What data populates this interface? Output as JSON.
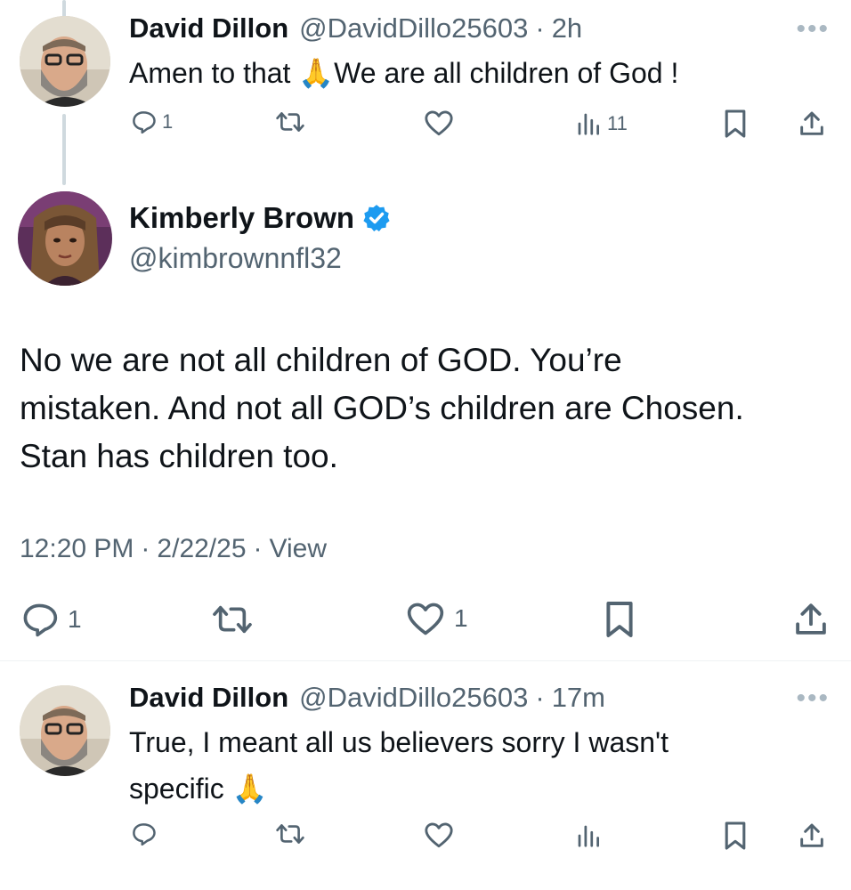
{
  "reply1": {
    "name": "David Dillon",
    "handle": "@DavidDillo25603",
    "time": "2h",
    "text": "Amen to that 🙏We are all children of God !",
    "actions": {
      "replies": "1",
      "reposts": "",
      "likes": "",
      "views": "11"
    }
  },
  "main": {
    "name": "Kimberly Brown",
    "handle": "@kimbrownnfl32",
    "verified": true,
    "text_lines": [
      "No we are not all children of GOD.  You’re",
      "mistaken.  And not all GOD’s children are Chosen.",
      "Stan has children too."
    ],
    "time": "12:20 PM",
    "date": "2/22/25",
    "view_link": "View",
    "actions": {
      "replies": "1",
      "reposts": "",
      "likes": "1"
    }
  },
  "reply2": {
    "name": "David Dillon",
    "handle": "@DavidDillo25603",
    "time": "17m",
    "text_lines": [
      "True, I meant all us believers sorry I wasn't",
      "specific 🙏"
    ],
    "actions": {
      "replies": "",
      "reposts": "",
      "likes": "",
      "views": ""
    }
  },
  "colors": {
    "text": "#0f1419",
    "secondary": "#536471",
    "verified": "#1d9bf0",
    "thread_line": "#cfd9de"
  },
  "icons": [
    "reply-icon",
    "repost-icon",
    "like-icon",
    "views-icon",
    "bookmark-icon",
    "share-icon",
    "more-icon",
    "verified-badge-icon"
  ]
}
